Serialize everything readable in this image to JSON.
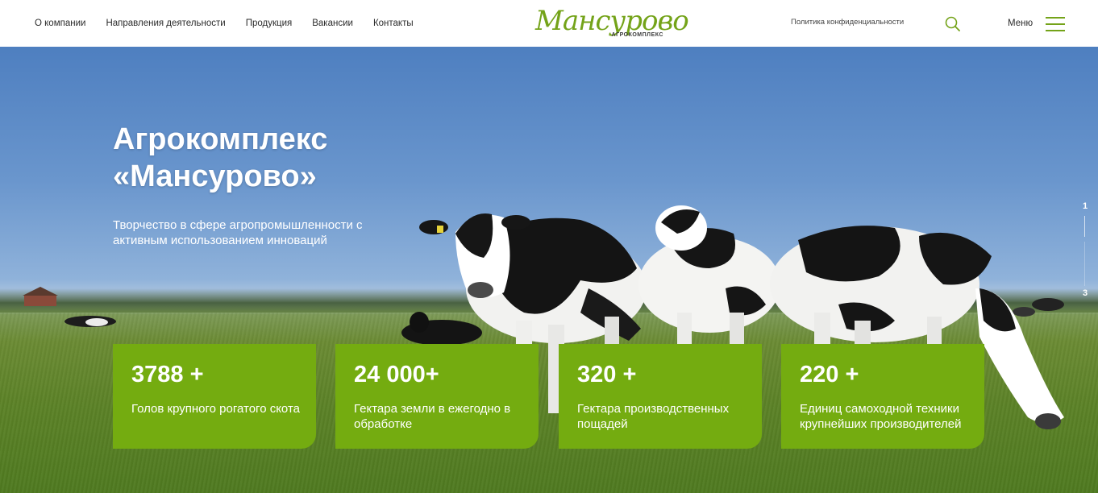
{
  "header": {
    "nav": [
      {
        "label": "О компании"
      },
      {
        "label": "Направления деятельности"
      },
      {
        "label": "Продукция"
      },
      {
        "label": "Вакансии"
      },
      {
        "label": "Контакты"
      }
    ],
    "logo": {
      "word": "Мансурово",
      "sub": "АГРОКОМПЛЕКС"
    },
    "privacy_link": "Политика конфиденциальности",
    "search_icon": "search-icon",
    "menu_label": "Меню",
    "menu_icon": "hamburger-icon",
    "accent_color": "#74a319"
  },
  "hero": {
    "title": "Агрокомплекс «Мансурово»",
    "subtitle": "Творчество в сфере агропромышленности с активным использованием инноваций",
    "pager": {
      "current": "1",
      "last": "3"
    },
    "stats": [
      {
        "value": "3788 +",
        "label": "Голов крупного рогатого скота"
      },
      {
        "value": "24 000+",
        "label": "Гектара земли в ежегодно в обработке"
      },
      {
        "value": "320 +",
        "label": "Гектара производственных пощадей"
      },
      {
        "value": "220 +",
        "label": "Единиц самоходной техники крупнейших производителей"
      }
    ],
    "stat_color": "#74ac10"
  }
}
